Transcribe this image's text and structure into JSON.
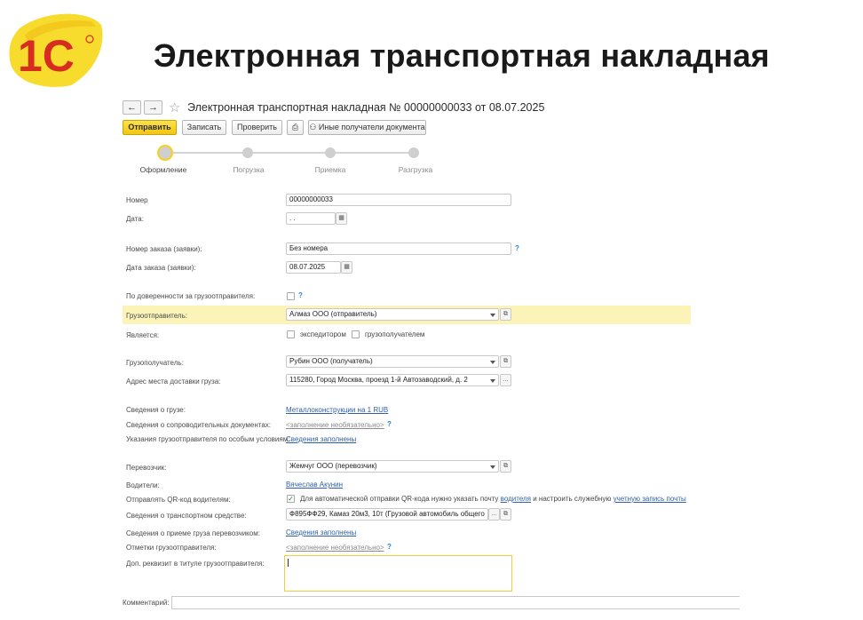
{
  "slide": {
    "logo_text": "1С",
    "title": "Электронная транспортная накладная"
  },
  "window": {
    "title": "Электронная транспортная накладная № 00000000033 от 08.07.2025",
    "nav_back": "←",
    "nav_forward": "→",
    "star": "☆"
  },
  "toolbar": {
    "send": "Отправить",
    "save": "Записать",
    "check": "Проверить",
    "print_icon": "printer-icon",
    "print_glyph": "⎙",
    "other_recipients": "Иные получатели документа"
  },
  "stages": [
    "Оформление",
    "Погрузка",
    "Приемка",
    "Разгрузка"
  ],
  "fields": {
    "number_label": "Номер",
    "number_value": "00000000033",
    "date_label": "Дата:",
    "date_value": " .  .",
    "order_number_label": "Номер заказа (заявки):",
    "order_number_value": "Без номера",
    "order_date_label": "Дата заказа (заявки):",
    "order_date_value": "08.07.2025",
    "proxy_label": "По доверенности за грузоотправителя:",
    "shipper_label": "Грузоотправитель:",
    "shipper_value": "Алмаз ООО (отправитель)",
    "is_label": "Является:",
    "forwarder_label": "экспедитором",
    "shipper_role_label": "грузополучателем",
    "consignee_label": "Грузополучатель:",
    "consignee_value": "Рубин ООО (получатель)",
    "address_label": "Адрес места доставки груза:",
    "address_value": "115280, Город Москва, проезд 1-й Автозаводский, д. 2",
    "cargo_label": "Сведения о грузе:",
    "cargo_value": "Металлоконструкции на 1 RUB",
    "docs_label": "Сведения о сопроводительных документах:",
    "docs_value": "<заполнение необязательно>",
    "special_label": "Указания грузоотправителя по особым условиям:",
    "special_value": "Сведения заполнены",
    "carrier_label": "Перевозчик:",
    "carrier_value": "Жемчуг ООО (перевозчик)",
    "drivers_label": "Водители:",
    "drivers_value": "Вячеслав Акунин",
    "qr_label": "Отправлять QR-код водителям:",
    "qr_text_1": "Для автоматической отправки QR-кода нужно указать почту",
    "qr_link_1": "водителя",
    "qr_text_2": "и настроить служебную",
    "qr_link_2": "учетную запись почты",
    "vehicle_label": "Сведения о транспортном средстве:",
    "vehicle_value": "Ф895ФФ29, Камаз 20м3, 10т (Грузовой автомобиль общего",
    "acceptance_label": "Сведения о приеме груза перевозчиком:",
    "acceptance_value": "Сведения заполнены",
    "marks_label": "Отметки грузоотправителя:",
    "marks_value": "<заполнение необязательно>",
    "extra_label": "Доп. реквизит в титуле грузоотправителя:",
    "comment_label": "Комментарий:"
  },
  "colors": {
    "accent_yellow": "#f1c614",
    "highlight_row": "#fbf3b8",
    "link": "#2f5fa8",
    "logo_red": "#d62d20"
  }
}
